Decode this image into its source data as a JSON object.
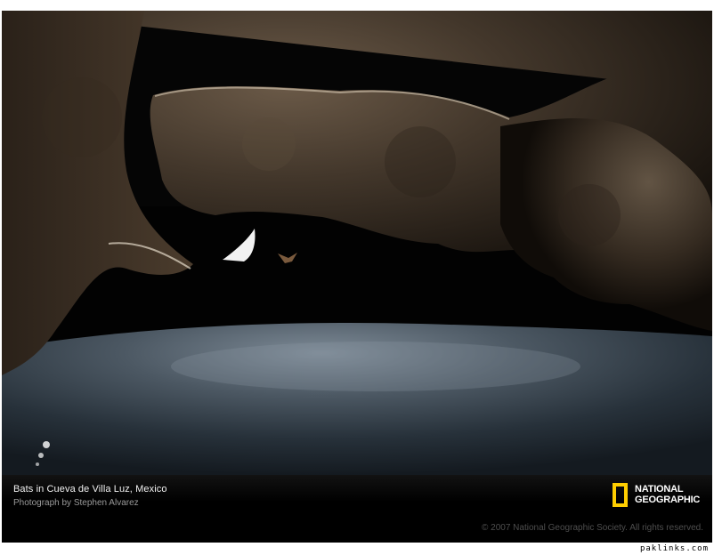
{
  "caption": {
    "title": "Bats in Cueva de Villa Luz, Mexico",
    "credit": "Photograph by Stephen Alvarez",
    "copyright": "© 2007 National Geographic Society. All rights reserved."
  },
  "logo": {
    "line1": "NATIONAL",
    "line2": "GEOGRAPHIC",
    "accent": "#ffce00"
  },
  "site_credit": "paklinks.com"
}
